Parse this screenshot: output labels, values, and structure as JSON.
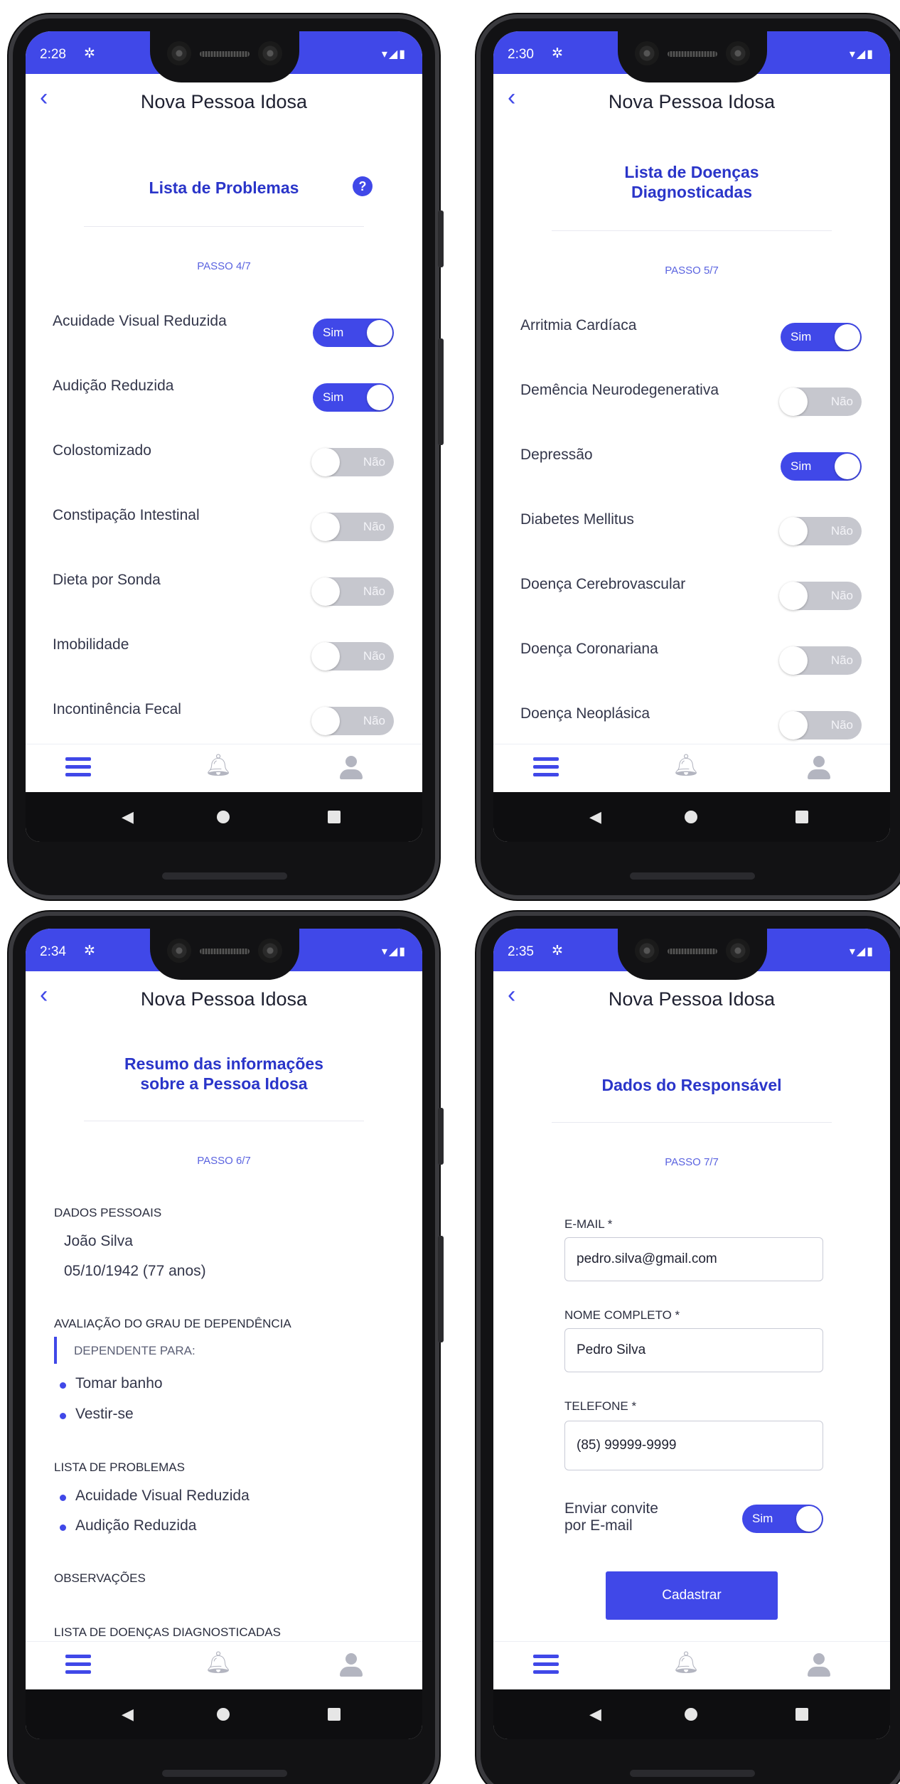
{
  "colors": {
    "accent": "#4048e8",
    "title": "#2a35c9",
    "toggle_off": "#c6c7ce"
  },
  "common": {
    "app_title": "Nova Pessoa Idosa",
    "back_icon": "chevron-left-icon",
    "nav": {
      "menu_icon": "menu-icon",
      "bell_icon": "bell-icon",
      "profile_icon": "user-icon"
    },
    "sysnav": {
      "back": "back-icon",
      "home": "home-icon",
      "recents": "recents-icon"
    }
  },
  "screen1": {
    "time": "2:28",
    "title": "Lista de Problemas",
    "help": "?",
    "step": "PASSO 4/7",
    "items": [
      {
        "label": "Acuidade Visual Reduzida",
        "state": "Sim",
        "on": true
      },
      {
        "label": "Audição Reduzida",
        "state": "Sim",
        "on": true
      },
      {
        "label": "Colostomizado",
        "state": "Não",
        "on": false
      },
      {
        "label": "Constipação Intestinal",
        "state": "Não",
        "on": false
      },
      {
        "label": "Dieta por Sonda",
        "state": "Não",
        "on": false
      },
      {
        "label": "Imobilidade",
        "state": "Não",
        "on": false
      },
      {
        "label": "Incontinência Fecal",
        "state": "Não",
        "on": false
      }
    ]
  },
  "screen2": {
    "time": "2:30",
    "title_line1": "Lista de Doenças",
    "title_line2": "Diagnosticadas",
    "step": "PASSO 5/7",
    "items": [
      {
        "label": "Arritmia Cardíaca",
        "state": "Sim",
        "on": true
      },
      {
        "label": "Demência Neurodegenerativa",
        "state": "Não",
        "on": false
      },
      {
        "label": "Depressão",
        "state": "Sim",
        "on": true
      },
      {
        "label": "Diabetes Mellitus",
        "state": "Não",
        "on": false
      },
      {
        "label": "Doença Cerebrovascular",
        "state": "Não",
        "on": false
      },
      {
        "label": "Doença Coronariana",
        "state": "Não",
        "on": false
      },
      {
        "label": "Doença Neoplásica",
        "state": "Não",
        "on": false
      }
    ]
  },
  "screen3": {
    "time": "2:34",
    "title_line1": "Resumo das informações",
    "title_line2": "sobre a Pessoa Idosa",
    "step": "PASSO 6/7",
    "personal_heading": "DADOS PESSOAIS",
    "name": "João Silva",
    "birth": "05/10/1942 (77 anos)",
    "dependency_heading": "AVALIAÇÃO DO GRAU DE DEPENDÊNCIA",
    "dependent_for": "DEPENDENTE PARA:",
    "dependency_items": [
      "Tomar banho",
      "Vestir-se"
    ],
    "problems_heading": "LISTA DE PROBLEMAS",
    "problems_items": [
      "Acuidade Visual Reduzida",
      "Audição Reduzida"
    ],
    "observations_heading": "OBSERVAÇÕES",
    "diseases_heading": "LISTA DE DOENÇAS DIAGNOSTICADAS"
  },
  "screen4": {
    "time": "2:35",
    "title": "Dados do Responsável",
    "step": "PASSO 7/7",
    "email_label": "E-MAIL *",
    "email_value": "pedro.silva@gmail.com",
    "name_label": "NOME COMPLETO *",
    "name_value": "Pedro Silva",
    "phone_label": "TELEFONE *",
    "phone_value": "(85) 99999-9999",
    "invite_line1": "Enviar convite",
    "invite_line2": "por E-mail",
    "invite_state": "Sim",
    "submit": "Cadastrar"
  }
}
